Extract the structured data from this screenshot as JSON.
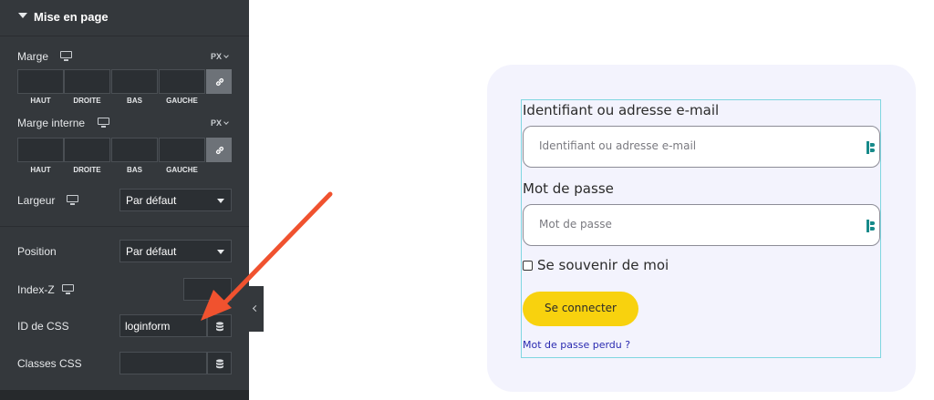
{
  "panel": {
    "section_title": "Mise en page",
    "margin": {
      "label": "Marge",
      "unit": "PX",
      "sides": [
        "HAUT",
        "DROITE",
        "BAS",
        "GAUCHE"
      ]
    },
    "padding": {
      "label": "Marge interne",
      "unit": "PX",
      "sides": [
        "HAUT",
        "DROITE",
        "BAS",
        "GAUCHE"
      ]
    },
    "width": {
      "label": "Largeur",
      "value": "Par défaut"
    },
    "position": {
      "label": "Position",
      "value": "Par défaut"
    },
    "zindex": {
      "label": "Index-Z",
      "value": ""
    },
    "css_id": {
      "label": "ID de CSS",
      "value": "loginform"
    },
    "css_classes": {
      "label": "Classes CSS",
      "value": ""
    }
  },
  "preview": {
    "username_label": "Identifiant ou adresse e-mail",
    "username_placeholder": "Identifiant ou adresse e-mail",
    "password_label": "Mot de passe",
    "password_placeholder": "Mot de passe",
    "remember_label": "Se souvenir de moi",
    "remember_checked": false,
    "submit_label": "Se connecter",
    "lost_password_link": "Mot de passe perdu ?"
  },
  "colors": {
    "panel_bg": "#34383c",
    "annotation_arrow": "#f0522f",
    "card_bg": "#f3f3fd",
    "button_yellow": "#f8d20e",
    "link_blue": "#2a2ab0",
    "frame_outline": "#7fd6e0"
  },
  "icons": [
    "caret-down-icon",
    "monitor-icon",
    "link-icon",
    "database-icon",
    "chevron-left-icon",
    "password-manager-icon"
  ]
}
